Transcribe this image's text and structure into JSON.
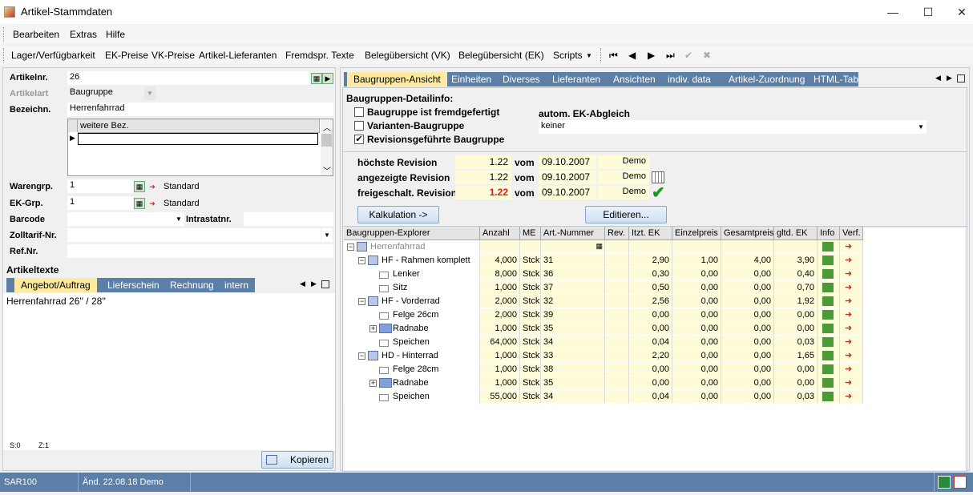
{
  "window": {
    "title": "Artikel-Stammdaten",
    "min": "—",
    "max": "☐",
    "close": "✕"
  },
  "menu": [
    "Bearbeiten",
    "Extras",
    "Hilfe"
  ],
  "toolbar": {
    "items": [
      "Lager/Verfügbarkeit",
      "EK-Preise",
      "VK-Preise",
      "Artikel-Lieferanten",
      "Fremdspr. Texte",
      "Belegübersicht (VK)",
      "Belegübersicht (EK)",
      "Scripts"
    ],
    "nav": [
      "⏮",
      "◀",
      "▶",
      "⏭",
      "✔",
      "✖"
    ]
  },
  "left": {
    "artikelnr_label": "Artikelnr.",
    "artikelnr": "26",
    "artikelart_label": "Artikelart",
    "artikelart": "Baugruppe",
    "bezeichn_label": "Bezeichn.",
    "bezeichn": "Herrenfahrrad",
    "weitere_bez": "weitere Bez.",
    "warengrp_label": "Warengrp.",
    "warengrp": "1",
    "warengrp_text": "Standard",
    "ekgrp_label": "EK-Grp.",
    "ekgrp": "1",
    "ekgrp_text": "Standard",
    "barcode_label": "Barcode",
    "intrastat_label": "Intrastatnr.",
    "zolltarif_label": "Zolltarif-Nr.",
    "refnr_label": "Ref.Nr.",
    "artikeltexte_label": "Artikeltexte",
    "text_tabs": [
      "Angebot/Auftrag",
      "Lieferschein",
      "Rechnung",
      "intern"
    ],
    "text_content": "Herrenfahrrad 26'' / 28''",
    "pos_s": "S:0",
    "pos_z": "Z:1",
    "kopieren": "Kopieren"
  },
  "right": {
    "tabs": [
      "Baugruppen-Ansicht",
      "Einheiten",
      "Diverses",
      "Lieferanten",
      "Ansichten",
      "indiv. data",
      "Artikel-Zuordnung",
      "HTML-Tab"
    ],
    "detail_title": "Baugruppen-Detailinfo:",
    "chk1": "Baugruppe ist fremdgefertigt",
    "chk1_checked": false,
    "chk2": "Varianten-Baugruppe",
    "chk2_checked": false,
    "chk3": "Revisionsgeführte Baugruppe",
    "chk3_checked": true,
    "autom_label": "autom. EK-Abgleich",
    "autom_value": "keiner",
    "rev": [
      {
        "label": "höchste Revision",
        "value": "1.22",
        "vom": "vom",
        "date": "09.10.2007",
        "user": "Demo",
        "red": false
      },
      {
        "label": "angezeigte Revision",
        "value": "1.22",
        "vom": "vom",
        "date": "09.10.2007",
        "user": "Demo",
        "red": false
      },
      {
        "label": "freigeschalt. Revision",
        "value": "1.22",
        "vom": "vom",
        "date": "09.10.2007",
        "user": "Demo",
        "red": true
      }
    ],
    "kalk_btn": "Kalkulation ->",
    "edit_btn": "Editieren..."
  },
  "grid": {
    "headers": [
      "Baugruppen-Explorer",
      "Anzahl",
      "ME",
      "Art.-Nummer",
      "Rev.",
      "Itzt. EK",
      "Einzelpreis",
      "Gesamtpreis",
      "gltd. EK",
      "Info",
      "Verf."
    ],
    "rows": [
      {
        "level": 0,
        "exp": "−",
        "icon": "house",
        "name": "Herrenfahrrad",
        "anzahl": "",
        "me": "",
        "art": "",
        "ek": "",
        "ep": "",
        "gp": "",
        "gek": ""
      },
      {
        "level": 1,
        "exp": "−",
        "icon": "house",
        "name": "HF - Rahmen komplett",
        "anzahl": "4,000",
        "me": "Stck",
        "art": "31",
        "ek": "2,90",
        "ep": "1,00",
        "gp": "4,00",
        "gek": "3,90"
      },
      {
        "level": 2,
        "exp": "",
        "icon": "folder",
        "name": "Lenker",
        "anzahl": "8,000",
        "me": "Stck",
        "art": "36",
        "ek": "0,30",
        "ep": "0,00",
        "gp": "0,00",
        "gek": "0,40"
      },
      {
        "level": 2,
        "exp": "",
        "icon": "folder",
        "name": "Sitz",
        "anzahl": "1,000",
        "me": "Stck",
        "art": "37",
        "ek": "0,50",
        "ep": "0,00",
        "gp": "0,00",
        "gek": "0,70"
      },
      {
        "level": 1,
        "exp": "−",
        "icon": "house",
        "name": "HF - Vorderrad",
        "anzahl": "2,000",
        "me": "Stck",
        "art": "32",
        "ek": "2,56",
        "ep": "0,00",
        "gp": "0,00",
        "gek": "1,92"
      },
      {
        "level": 2,
        "exp": "",
        "icon": "folder",
        "name": "Felge 26cm",
        "anzahl": "2,000",
        "me": "Stck",
        "art": "39",
        "ek": "0,00",
        "ep": "0,00",
        "gp": "0,00",
        "gek": "0,00"
      },
      {
        "level": 2,
        "exp": "+",
        "icon": "grid",
        "name": "Radnabe",
        "anzahl": "1,000",
        "me": "Stck",
        "art": "35",
        "ek": "0,00",
        "ep": "0,00",
        "gp": "0,00",
        "gek": "0,00"
      },
      {
        "level": 2,
        "exp": "",
        "icon": "folder",
        "name": "Speichen",
        "anzahl": "64,000",
        "me": "Stck",
        "art": "34",
        "ek": "0,04",
        "ep": "0,00",
        "gp": "0,00",
        "gek": "0,03"
      },
      {
        "level": 1,
        "exp": "−",
        "icon": "house",
        "name": "HD - Hinterrad",
        "anzahl": "1,000",
        "me": "Stck",
        "art": "33",
        "ek": "2,20",
        "ep": "0,00",
        "gp": "0,00",
        "gek": "1,65"
      },
      {
        "level": 2,
        "exp": "",
        "icon": "folder",
        "name": "Felge 28cm",
        "anzahl": "1,000",
        "me": "Stck",
        "art": "38",
        "ek": "0,00",
        "ep": "0,00",
        "gp": "0,00",
        "gek": "0,00"
      },
      {
        "level": 2,
        "exp": "+",
        "icon": "grid",
        "name": "Radnabe",
        "anzahl": "1,000",
        "me": "Stck",
        "art": "35",
        "ek": "0,00",
        "ep": "0,00",
        "gp": "0,00",
        "gek": "0,00"
      },
      {
        "level": 2,
        "exp": "",
        "icon": "folder",
        "name": "Speichen",
        "anzahl": "55,000",
        "me": "Stck",
        "art": "34",
        "ek": "0,04",
        "ep": "0,00",
        "gp": "0,00",
        "gek": "0,03"
      }
    ]
  },
  "status": {
    "code": "SAR100",
    "changed": "Änd. 22.08.18 Demo"
  }
}
